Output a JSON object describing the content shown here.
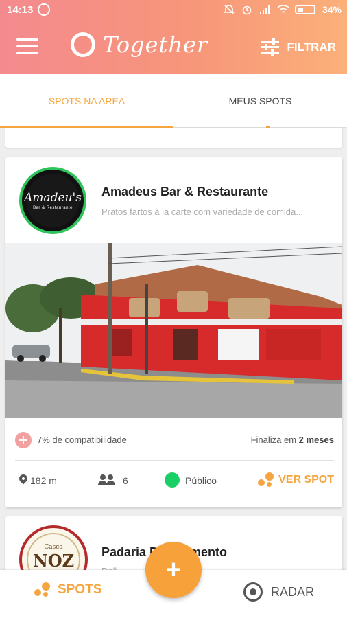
{
  "status_bar": {
    "time": "14:13",
    "battery": "34%"
  },
  "header": {
    "app_name": "Together",
    "filter_label": "FILTRAR"
  },
  "tabs": [
    {
      "label": "SPOTS NA AREA",
      "active": true
    },
    {
      "label": "MEUS SPOTS",
      "active": false
    }
  ],
  "spots": [
    {
      "avatar_text": "Amadeu's",
      "avatar_subtext": "Bar & Restaurante",
      "title": "Amadeus Bar & Restaurante",
      "description": "Pratos fartos à la carte com variedade de comida...",
      "compatibility": "7% de compatibilidade",
      "ends_prefix": "Finaliza em",
      "ends_value": "2 meses",
      "distance": "182 m",
      "participants": "6",
      "visibility": "Público",
      "action": "VER SPOT"
    },
    {
      "avatar_text_top": "Casca",
      "avatar_text": "NOZ",
      "title": "Padaria D... Momento",
      "description": "Deli... ..."
    }
  ],
  "bottom_nav": {
    "spots_label": "SPOTS",
    "radar_label": "RADAR"
  },
  "fab": {
    "label": "+"
  },
  "colors": {
    "accent": "#f5a540",
    "header_start": "#f48a8e",
    "header_end": "#fbb079",
    "public_green": "#19d066"
  }
}
